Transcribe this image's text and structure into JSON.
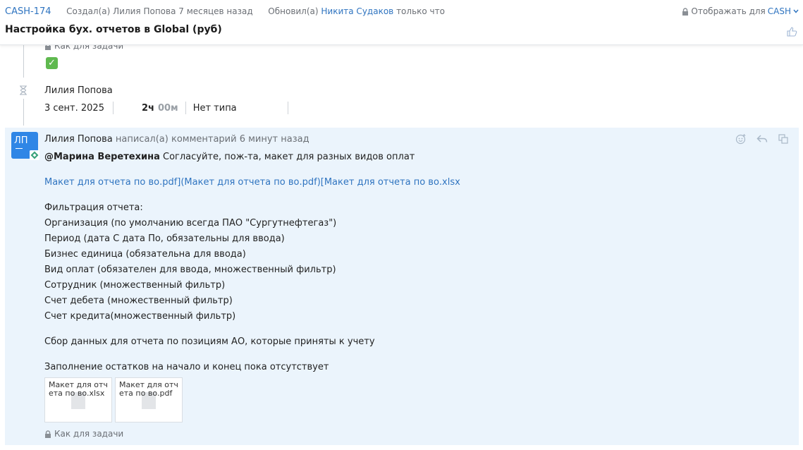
{
  "header": {
    "issue_key": "CASH-174",
    "created_text": "Создал(а) Лилия Попова 7 месяцев назад",
    "updated_prefix": "Обновил(а)",
    "updated_user": "Никита Судаков",
    "updated_suffix": "только что",
    "visibility_label": "Отображать для",
    "visibility_project": "CASH",
    "title": "Настройка бух. отчетов в Global (руб)"
  },
  "previous_entry": {
    "visibility_label": "Как для задачи",
    "checkbox_checked": true
  },
  "worklog": {
    "author": "Лилия Попова",
    "date": "3 сент. 2025",
    "time_hours": "2ч",
    "time_minutes": "00м",
    "type": "Нет типа"
  },
  "comment": {
    "avatar_initials": "ЛП",
    "author": "Лилия Попова",
    "action": "написал(а) комментарий 6 минут назад",
    "mention": "@Марина Веретехина",
    "first_line": " Согласуйте, пож-та, макет для разных видов оплат",
    "links_line": "Макет для отчета по во.pdf](Макет для отчета по во.pdf)[Макет для отчета по во.xlsx",
    "filter_lines": [
      "Фильтрация отчета:",
      "Организация (по умолчанию всегда ПАО \"Сургутнефтегаз\")",
      "Период (дата С дата По, обязательны для ввода)",
      "Бизнес единица (обязательна для ввода)",
      "Вид оплат (обязателен для ввода, множественный фильтр)",
      "Сотрудник (множественный фильтр)",
      "Счет дебета (множественный фильтр)",
      "Счет кредита(множественный фильтр)"
    ],
    "collection_line": "Сбор данных для отчета по позициям АО, которые приняты к учету",
    "balance_line": "Заполнение остатков на начало и конец пока отсутствует",
    "attachments": [
      {
        "name": "Макет для отчета по во.xlsx"
      },
      {
        "name": "Макет для отчета по во.pdf"
      }
    ],
    "visibility_label": "Как для задачи"
  },
  "colors": {
    "accent": "#2f74c0",
    "avatar": "#2f86e6",
    "comment_bg": "#ebf4fc",
    "check_green": "#5fb94f"
  },
  "icons": [
    "lock-icon",
    "chevron-down-icon",
    "thumbs-up-icon",
    "hourglass-icon",
    "emoji-icon",
    "reply-icon",
    "copy-icon"
  ]
}
